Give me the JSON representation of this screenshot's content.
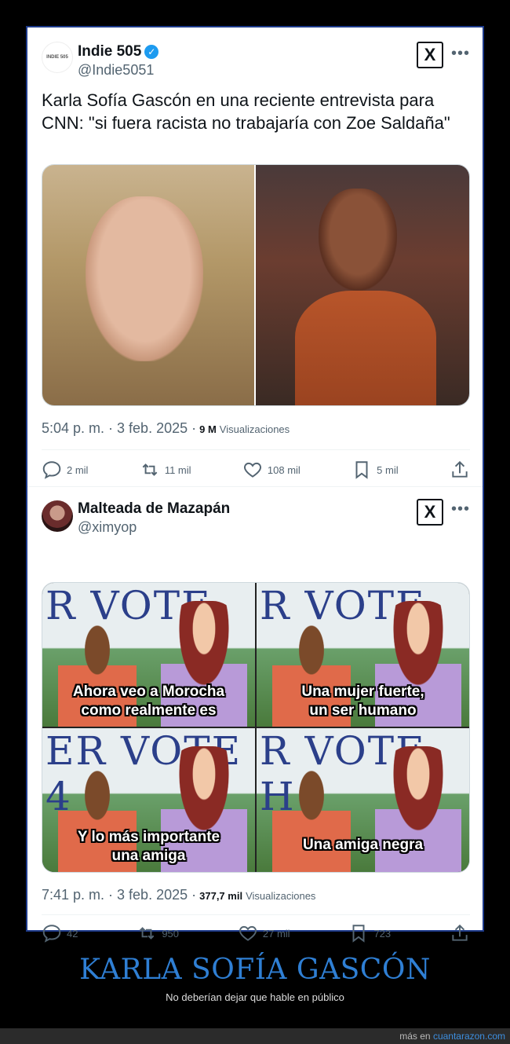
{
  "tweets": [
    {
      "author_name": "Indie 505",
      "handle": "@Indie5051",
      "avatar_text": "INDIE 505",
      "verified_icon": "verified-badge-icon",
      "text": "Karla Sofía Gascón en una reciente entrevista para CNN: \"si fuera racista no trabajaría con Zoe Saldaña\"",
      "time": "5:04 p. m. · 3 feb. 2025 ·",
      "views_count": "9 M",
      "views_label": "Visualizaciones",
      "replies": "2 mil",
      "retweets": "11 mil",
      "likes": "108 mil",
      "bookmarks": "5 mil"
    },
    {
      "author_name": "Malteada de Mazapán",
      "handle": "@ximyop",
      "time": "7:41 p. m. · 3 feb. 2025 ·",
      "views_count": "377,7 mil",
      "views_label": "Visualizaciones",
      "replies": "42",
      "retweets": "950",
      "likes": "27 mil",
      "bookmarks": "723",
      "meme_panels": [
        {
          "banner": "R VOTE",
          "caption_line1": "Ahora veo a Morocha",
          "caption_line2": "como realmente es"
        },
        {
          "banner": "R VOTE",
          "caption_line1": "Una mujer fuerte,",
          "caption_line2": "un ser humano"
        },
        {
          "banner": "ER VOTE 4",
          "caption_line1": "Y lo más importante",
          "caption_line2": "una amiga"
        },
        {
          "banner": "R VOTE H",
          "caption_line1": "Una amiga negra",
          "caption_line2": ""
        }
      ]
    }
  ],
  "footer": {
    "title": "KARLA SOFÍA GASCÓN",
    "subtitle": "No deberían dejar que hable en público",
    "more_prefix": "más en",
    "site": "cuantarazon.com"
  },
  "colors": {
    "accent_blue": "#1d9bf0",
    "footer_title": "#2f7fd4",
    "card_border": "#1d3a8a"
  }
}
